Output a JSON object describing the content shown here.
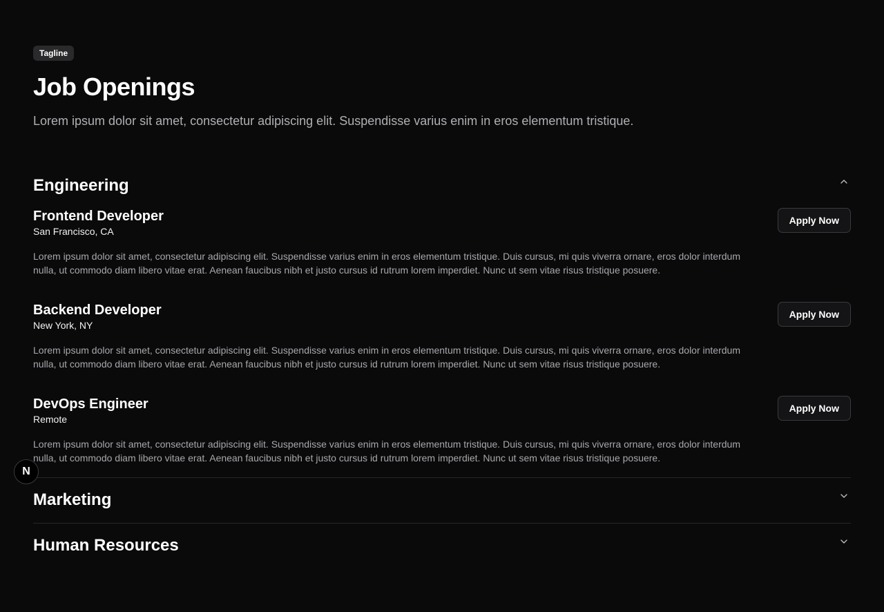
{
  "header": {
    "tagline": "Tagline",
    "title": "Job Openings",
    "subtitle": "Lorem ipsum dolor sit amet, consectetur adipiscing elit. Suspendisse varius enim in eros elementum tristique."
  },
  "departments": [
    {
      "name": "Engineering",
      "expanded": true,
      "jobs": [
        {
          "title": "Frontend Developer",
          "location": "San Francisco, CA",
          "description": "Lorem ipsum dolor sit amet, consectetur adipiscing elit. Suspendisse varius enim in eros elementum tristique. Duis cursus, mi quis viverra ornare, eros dolor interdum nulla, ut commodo diam libero vitae erat. Aenean faucibus nibh et justo cursus id rutrum lorem imperdiet. Nunc ut sem vitae risus tristique posuere.",
          "apply_label": "Apply Now"
        },
        {
          "title": "Backend Developer",
          "location": "New York, NY",
          "description": "Lorem ipsum dolor sit amet, consectetur adipiscing elit. Suspendisse varius enim in eros elementum tristique. Duis cursus, mi quis viverra ornare, eros dolor interdum nulla, ut commodo diam libero vitae erat. Aenean faucibus nibh et justo cursus id rutrum lorem imperdiet. Nunc ut sem vitae risus tristique posuere.",
          "apply_label": "Apply Now"
        },
        {
          "title": "DevOps Engineer",
          "location": "Remote",
          "description": "Lorem ipsum dolor sit amet, consectetur adipiscing elit. Suspendisse varius enim in eros elementum tristique. Duis cursus, mi quis viverra ornare, eros dolor interdum nulla, ut commodo diam libero vitae erat. Aenean faucibus nibh et justo cursus id rutrum lorem imperdiet. Nunc ut sem vitae risus tristique posuere.",
          "apply_label": "Apply Now"
        }
      ]
    },
    {
      "name": "Marketing",
      "expanded": false
    },
    {
      "name": "Human Resources",
      "expanded": false
    }
  ],
  "badge": {
    "letter": "N",
    "icon": "nextjs-icon"
  },
  "colors": {
    "background": "#0a0a0b",
    "text": "#ffffff",
    "muted_text": "#a8a8ac",
    "divider": "#26262a",
    "tagline_bg": "#2a2a2c",
    "button_border": "#3a3a3e"
  }
}
